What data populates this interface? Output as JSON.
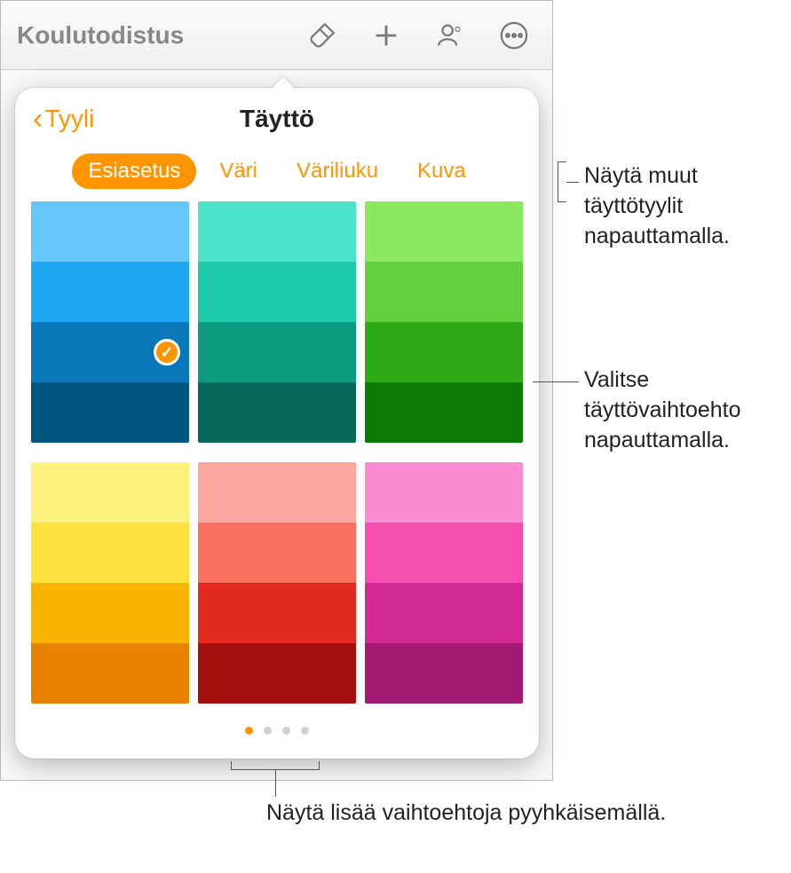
{
  "toolbar": {
    "title": "Koulutodistus"
  },
  "popover": {
    "back_label": "Tyyli",
    "title": "Täyttö",
    "tabs": {
      "preset": "Esiasetus",
      "color": "Väri",
      "gradient": "Väriliuku",
      "image": "Kuva"
    }
  },
  "swatches": {
    "groups": [
      {
        "colors": [
          "#67c7fb",
          "#1ea8f4",
          "#0a77b8",
          "#00567e"
        ],
        "selected_index": 2
      },
      {
        "colors": [
          "#4de5c9",
          "#1dcbab",
          "#0d9b80",
          "#08695a"
        ]
      },
      {
        "colors": [
          "#89e85e",
          "#62d03a",
          "#2fa815",
          "#0b7a05"
        ]
      },
      {
        "colors": [
          "#fef180",
          "#fde141",
          "#f9b400",
          "#e88100"
        ]
      },
      {
        "colors": [
          "#fba8a0",
          "#fb6f5f",
          "#e22a20",
          "#a30e0e"
        ]
      },
      {
        "colors": [
          "#fa8cd1",
          "#f54eb0",
          "#d12a92",
          "#a01a72"
        ]
      }
    ]
  },
  "pagination": {
    "count": 4,
    "active": 0
  },
  "callouts": {
    "tabs": "Näytä muut täyttötyylit napauttamalla.",
    "swatch": "Valitse täyttövaihtoehto napauttamalla.",
    "dots": "Näytä lisää vaihtoehtoja pyyhkäisemällä."
  }
}
